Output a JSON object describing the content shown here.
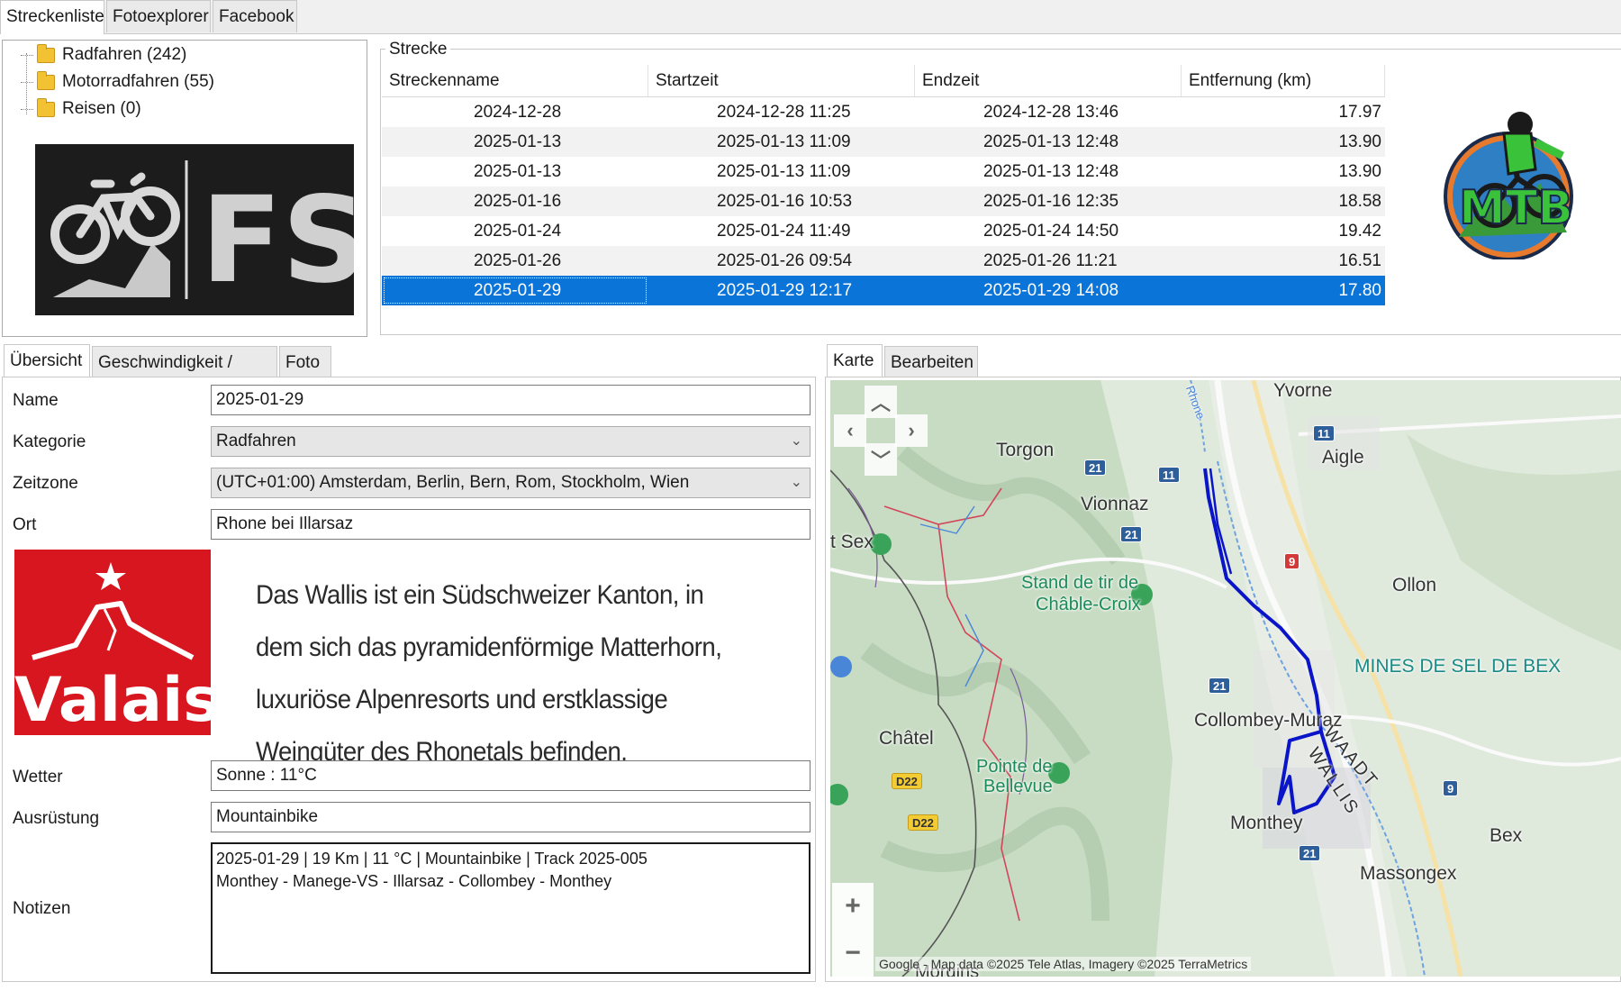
{
  "top_tabs": [
    "Streckenliste",
    "Fotoexplorer",
    "Facebook"
  ],
  "tree": [
    {
      "label": "Radfahren (242)"
    },
    {
      "label": "Motorradfahren (55)"
    },
    {
      "label": "Reisen (0)"
    }
  ],
  "fs_logo": {
    "text": "FS"
  },
  "strecke": {
    "group_label": "Strecke",
    "columns": [
      "Streckenname",
      "Startzeit",
      "Endzeit",
      "Entfernung (km)"
    ],
    "rows": [
      {
        "name": "2024-12-28",
        "start": "2024-12-28 11:25",
        "end": "2024-12-28 13:46",
        "km": "17.97"
      },
      {
        "name": "2025-01-13",
        "start": "2025-01-13 11:09",
        "end": "2025-01-13 12:48",
        "km": "13.90"
      },
      {
        "name": "2025-01-13",
        "start": "2025-01-13 11:09",
        "end": "2025-01-13 12:48",
        "km": "13.90"
      },
      {
        "name": "2025-01-16",
        "start": "2025-01-16 10:53",
        "end": "2025-01-16 12:35",
        "km": "18.58"
      },
      {
        "name": "2025-01-24",
        "start": "2025-01-24 11:49",
        "end": "2025-01-24 14:50",
        "km": "19.42"
      },
      {
        "name": "2025-01-26",
        "start": "2025-01-26 09:54",
        "end": "2025-01-26 11:21",
        "km": "16.51"
      },
      {
        "name": "2025-01-29",
        "start": "2025-01-29 12:17",
        "end": "2025-01-29 14:08",
        "km": "17.80"
      }
    ],
    "selected_row": 6
  },
  "mtb_logo": {
    "text": "MTB"
  },
  "detail_tabs": [
    "Übersicht",
    "Geschwindigkeit / Höhe",
    "Foto"
  ],
  "map_tabs": [
    "Karte",
    "Bearbeiten"
  ],
  "form": {
    "name_label": "Name",
    "name_value": "2025-01-29",
    "kategorie_label": "Kategorie",
    "kategorie_value": "Radfahren",
    "zeitzone_label": "Zeitzone",
    "zeitzone_value": "(UTC+01:00) Amsterdam, Berlin, Bern, Rom, Stockholm, Wien",
    "ort_label": "Ort",
    "ort_value": "Rhone bei Illarsaz",
    "wetter_label": "Wetter",
    "wetter_value": "Sonne  :  11°C",
    "ausruestung_label": "Ausrüstung",
    "ausruestung_value": "Mountainbike",
    "notizen_label": "Notizen",
    "notizen_line1": "2025-01-29  |  19 Km  |  11 °C  |  Mountainbike  |  Track 2025-005",
    "notizen_line2": "Monthey - Manege-VS - Illarsaz - Collombey - Monthey"
  },
  "valais": {
    "text": "Valais"
  },
  "description": "Das Wallis ist ein Südschweizer Kanton, in dem sich das pyramidenförmige Matterhorn, luxuriöse Alpenresorts und erstklassige Weingüter des Rhonetals befinden.",
  "map": {
    "labels": {
      "yvorne": "Yvorne",
      "aigle": "Aigle",
      "torgon": "Torgon",
      "vionnaz": "Vionnaz",
      "sex": "t Sex",
      "stand": "Stand de tir de",
      "chable": "Châble-Croix",
      "ollon": "Ollon",
      "mines": "MINES DE SEL DE BEX",
      "collombey": "Collombey-Muraz",
      "waadt": "WAADT",
      "wallis": "WALLIS",
      "chatel": "Châtel",
      "pointe": "Pointe de",
      "bellevue": "Bellevue",
      "monthey": "Monthey",
      "bex": "Bex",
      "massongex": "Massongex",
      "morgins": "Morgins",
      "rhone": "Rhone"
    },
    "shields": [
      "11",
      "11",
      "21",
      "21",
      "9",
      "21",
      "21",
      "D22",
      "D22",
      "9"
    ],
    "attribution": "Google - Map data ©2025 Tele Atlas, Imagery ©2025 TerraMetrics",
    "route_color": "#0a14c8"
  },
  "colors": {
    "selection": "#0a74d8",
    "valais_red": "#d7161f",
    "map_green": "#dfe9dc"
  }
}
